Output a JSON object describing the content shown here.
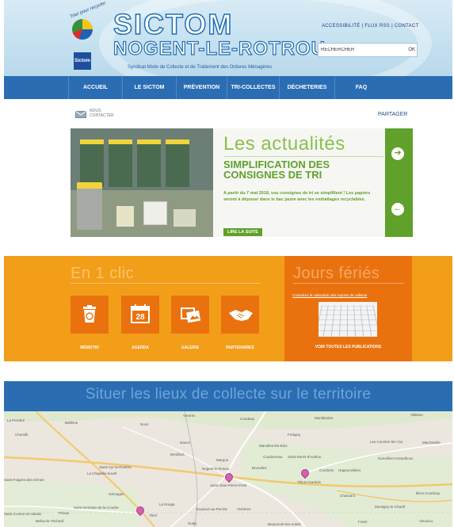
{
  "header": {
    "logo_arc_text": "Trier pour recycler",
    "logo_box_text": "Sictom",
    "title_line1": "SICTOM",
    "title_line2": "NOGENT-LE-ROTROU",
    "subtitle": "Syndicat Mixte de Collecte et de Traitement des Ordures Ménagères",
    "top_links": "ACCESSIBILITÉ | FLUX RSS | CONTACT",
    "search_placeholder": "RECHERCHER",
    "search_button": "OK"
  },
  "nav": {
    "items": [
      "ACCUEIL",
      "LE SICTOM",
      "PRÉVENTION",
      "TRI-COLLECTES",
      "DÉCHETERIES",
      "FAQ"
    ]
  },
  "utility": {
    "contact_line1": "NOUS",
    "contact_line2": "CONTACTER",
    "share": "PARTAGER"
  },
  "news": {
    "heading": "Les actualités",
    "title": "SIMPLIFICATION DES CONSIGNES DE TRI",
    "text": "A partir du 7 mai 2018, vos consignes de tri se simplifient ! Les papiers seront à déposer dans le bac jaune avec les emballages recyclables.",
    "read_more": "LIRE LA SUITE",
    "next_glyph": "➔",
    "prev_glyph": "←"
  },
  "quick_links": {
    "title": "En 1 clic",
    "tiles": [
      {
        "label": "MÉMOTRI",
        "icon": "trash-recycle-icon"
      },
      {
        "label": "AGENDA",
        "icon": "calendar-icon",
        "day": "28"
      },
      {
        "label": "GALERIE",
        "icon": "gallery-icon"
      },
      {
        "label": "PARTENAIRES",
        "icon": "handshake-icon"
      }
    ]
  },
  "holidays": {
    "title": "Jours fériés",
    "link": "Consultez le calendrier des reports de collecte",
    "publications": "VOIR TOUTES LES PUBLICATIONS"
  },
  "map_section": {
    "title": "Situer les lieux de collecte sur le territoire",
    "towns": [
      "La Perrière",
      "Bellême",
      "Nocé",
      "Vereres",
      "Condeau",
      "Montlandon",
      "Villebon",
      "Chemilli",
      "Dancé",
      "Fretigny",
      "Les Corvées-les-Yys",
      "Marchéville",
      "Berdhuis",
      "Margon",
      "Manolles-les-Bois",
      "Coudreceau",
      "Saint-Denis-d'Authou",
      "Nonvilliers-Grandhoux",
      "Saint-Cyr-la-Rosière",
      "La Chapelle-Souëf",
      "Nogent-le-Rotrou",
      "Brunelles",
      "Combres",
      "Happonvilliers",
      "Saint-Fulgent-des-Ormes",
      "Saint-Jean-Pierre-Fixte",
      "Thiron-Gardais",
      "Chassant",
      "Illiers-Combray",
      "Gémages",
      "La Rouge",
      "Souancé-au-Perche",
      "Vichères",
      "Montigny-le-Chartif",
      "Saint-Germain-de-la-Coudre",
      "Frazé",
      "Vieuvicq",
      "Bellou-le-Trichard",
      "Théil",
      "Beaumont-les-Autels",
      "Nolay",
      "Préval",
      "Saint-Cosme-en-Vairais"
    ]
  }
}
